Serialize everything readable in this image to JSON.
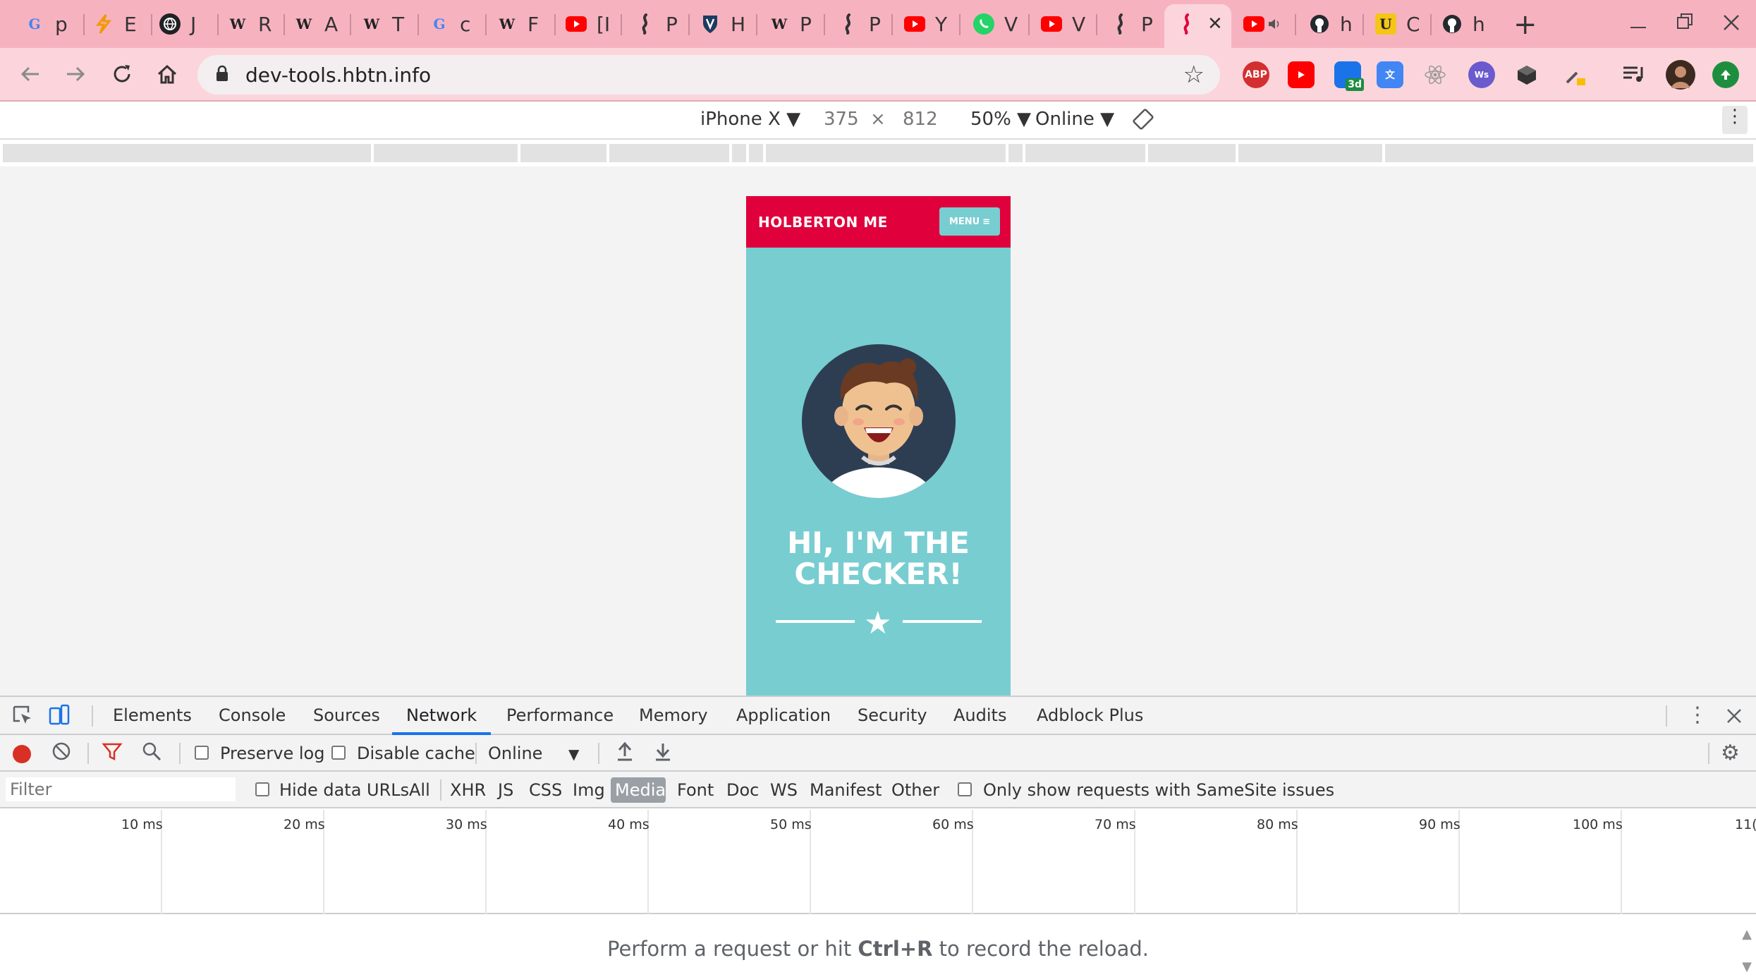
{
  "browser": {
    "tabs": [
      {
        "icon": "google-icon",
        "letter": "G",
        "label": "p"
      },
      {
        "icon": "flame-icon",
        "letter": "",
        "label": "E"
      },
      {
        "icon": "globe-icon",
        "letter": "",
        "label": "J"
      },
      {
        "icon": "wikipedia-icon",
        "letter": "W",
        "label": "R"
      },
      {
        "icon": "wikipedia-icon",
        "letter": "W",
        "label": "A"
      },
      {
        "icon": "wikipedia-icon",
        "letter": "W",
        "label": "T"
      },
      {
        "icon": "google-icon",
        "letter": "G",
        "label": "c"
      },
      {
        "icon": "wikipedia-icon",
        "letter": "W",
        "label": "F"
      },
      {
        "icon": "youtube-icon",
        "letter": "",
        "label": "[I"
      },
      {
        "icon": "holberton-icon",
        "letter": "",
        "label": "P"
      },
      {
        "icon": "shield-icon",
        "letter": "",
        "label": "H"
      },
      {
        "icon": "wikipedia-icon",
        "letter": "W",
        "label": "P"
      },
      {
        "icon": "holberton-icon",
        "letter": "",
        "label": "P"
      },
      {
        "icon": "youtube-icon",
        "letter": "",
        "label": "Y"
      },
      {
        "icon": "whatsapp-icon",
        "letter": "",
        "label": "V"
      },
      {
        "icon": "youtube-icon",
        "letter": "",
        "label": "V"
      },
      {
        "icon": "holberton-icon",
        "letter": "",
        "label": "P"
      },
      {
        "icon": "holberton-icon",
        "letter": "",
        "label": ""
      },
      {
        "icon": "youtube-icon",
        "letter": "",
        "label": ""
      },
      {
        "icon": "github-icon",
        "letter": "",
        "label": "h"
      },
      {
        "icon": "udacity-icon",
        "letter": "U",
        "label": "C"
      },
      {
        "icon": "github-icon",
        "letter": "",
        "label": "h"
      }
    ],
    "close_tab": "✕",
    "new_tab": "+",
    "url": "dev-tools.hbtn.info",
    "extensions": {
      "abp": "ABP",
      "badge": "3d"
    }
  },
  "device_toolbar": {
    "device": "iPhone X",
    "width": "375",
    "times": "×",
    "height": "812",
    "zoom": "50%",
    "throttle": "Online"
  },
  "page": {
    "brand": "HOLBERTON ME",
    "menu": "MENU",
    "headline_line1": "HI, I'M THE",
    "headline_line2": "CHECKER!"
  },
  "devtools": {
    "tabs": [
      "Elements",
      "Console",
      "Sources",
      "Network",
      "Performance",
      "Memory",
      "Application",
      "Security",
      "Audits",
      "Adblock Plus"
    ],
    "active_tab": "Network",
    "preserve_log": "Preserve log",
    "disable_cache": "Disable cache",
    "throttle": "Online",
    "filter_placeholder": "Filter",
    "hide_data_urls": "Hide data URLs",
    "type_filters": [
      "All",
      "XHR",
      "JS",
      "CSS",
      "Img",
      "Media",
      "Font",
      "Doc",
      "WS",
      "Manifest",
      "Other"
    ],
    "active_filter": "Media",
    "samesite": "Only show requests with SameSite issues",
    "ticks": [
      "10 ms",
      "20 ms",
      "30 ms",
      "40 ms",
      "50 ms",
      "60 ms",
      "70 ms",
      "80 ms",
      "90 ms",
      "100 ms",
      "11("
    ],
    "empty_prefix": "Perform a request or hit ",
    "empty_shortcut": "Ctrl+R",
    "empty_suffix": " to record the reload."
  },
  "colors": {
    "tabstrip": "#f7b2c0",
    "toolbar": "#fcd5dc",
    "holberton_red": "#e0003b",
    "teal": "#78cdd1",
    "record_red": "#d93025",
    "devtools_blue": "#1a73e8"
  }
}
